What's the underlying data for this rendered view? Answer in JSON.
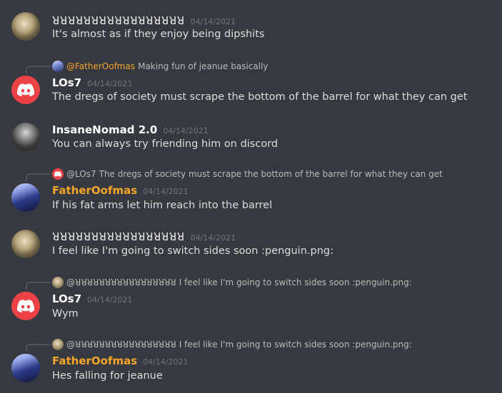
{
  "messages": [
    {
      "author": "ꓤꓤꓤꓤꓤꓤꓤꓤꓤꓤꓤꓤꓤꓤꓤꓤꓤ",
      "timestamp": "04/14/2021",
      "text": "It's almost as if they enjoy being dipshits",
      "avatar": "portrait-avatar"
    },
    {
      "reply": {
        "mention": "@FatherOofmas",
        "text": "Making fun of jeanue basically"
      },
      "author": "LOs7",
      "timestamp": "04/14/2021",
      "text": "The dregs of society must scrape the bottom of the barrel for what they can get",
      "avatar": "discord-avatar"
    },
    {
      "author": "InsaneNomad 2.0",
      "timestamp": "04/14/2021",
      "text": "You can always try friending him on discord",
      "avatar": "photo-avatar"
    },
    {
      "reply": {
        "mention": "@LOs7",
        "text": "The dregs of society must scrape the bottom of the barrel for what they can get"
      },
      "author": "FatherOofmas",
      "timestamp": "04/14/2021",
      "text": "If his fat arms let him reach into the barrel",
      "avatar": "anime-avatar"
    },
    {
      "author": "ꓤꓤꓤꓤꓤꓤꓤꓤꓤꓤꓤꓤꓤꓤꓤꓤꓤ",
      "timestamp": "04/14/2021",
      "text": "I feel like I'm going to switch sides soon :penguin.png:",
      "avatar": "portrait-avatar"
    },
    {
      "reply": {
        "mention": "@ꓤꓤꓤꓤꓤꓤꓤꓤꓤꓤꓤꓤꓤꓤꓤꓤꓤ",
        "text": "I feel like I'm going to switch sides soon :penguin.png:"
      },
      "author": "LOs7",
      "timestamp": "04/14/2021",
      "text": "Wym",
      "avatar": "discord-avatar"
    },
    {
      "reply": {
        "mention": "@ꓤꓤꓤꓤꓤꓤꓤꓤꓤꓤꓤꓤꓤꓤꓤꓤꓤ",
        "text": "I feel like I'm going to switch sides soon :penguin.png:"
      },
      "author": "FatherOofmas",
      "timestamp": "04/14/2021",
      "text": "Hes falling for jeanue",
      "avatar": "anime-avatar"
    }
  ],
  "colors": {
    "background": "#36393f",
    "text": "#dcddde",
    "timestamp": "#72767d",
    "discord_red": "#ed4245",
    "orange_name": "#f4a52a"
  }
}
